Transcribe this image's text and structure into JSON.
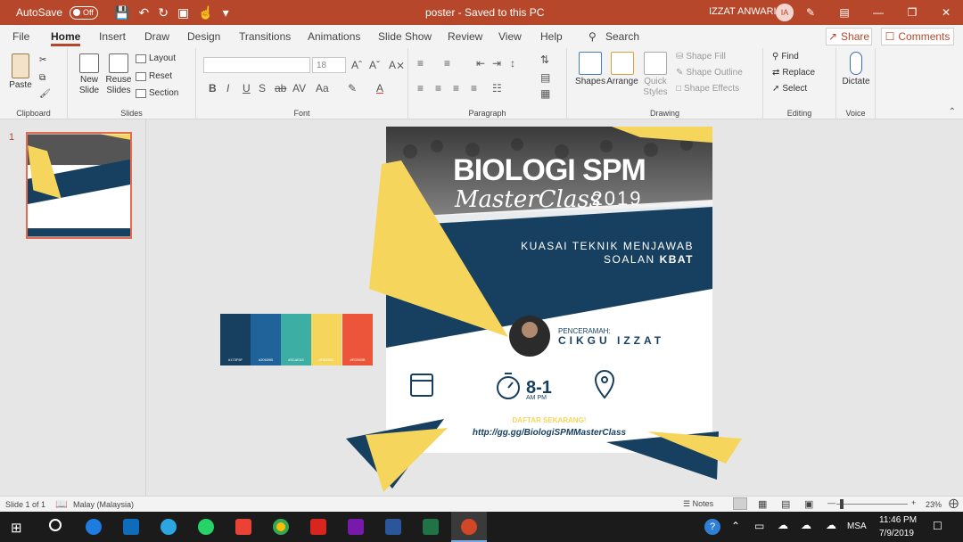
{
  "titlebar": {
    "autosave_label": "AutoSave",
    "autosave_state": "Off",
    "document_title": "poster  -  Saved to this PC",
    "user_name": "IZZAT ANWARI",
    "user_initials": "IA"
  },
  "tabs": [
    "File",
    "Home",
    "Insert",
    "Draw",
    "Design",
    "Transitions",
    "Animations",
    "Slide Show",
    "Review",
    "View",
    "Help"
  ],
  "search_label": "Search",
  "share_label": "Share",
  "comments_label": "Comments",
  "ribbon": {
    "clipboard": {
      "label": "Clipboard",
      "paste": "Paste"
    },
    "slides": {
      "label": "Slides",
      "new_slide": "New Slide",
      "reuse_slides": "Reuse Slides",
      "layout": "Layout",
      "reset": "Reset",
      "section": "Section"
    },
    "font": {
      "label": "Font",
      "font_name": "",
      "font_size": "18"
    },
    "paragraph": {
      "label": "Paragraph"
    },
    "drawing": {
      "label": "Drawing",
      "shapes": "Shapes",
      "arrange": "Arrange",
      "quick_styles": "Quick Styles",
      "shape_fill": "Shape Fill",
      "shape_outline": "Shape Outline",
      "shape_effects": "Shape Effects"
    },
    "editing": {
      "label": "Editing",
      "find": "Find",
      "replace": "Replace",
      "select": "Select"
    },
    "voice": {
      "label": "Voice",
      "dictate": "Dictate"
    }
  },
  "slide_panel": {
    "slide_number": "1"
  },
  "poster": {
    "title_main": "BIOLOGI SPM",
    "title_script": "MasterClass",
    "title_year": "2019",
    "tagline_line1": "KUASAI TEKNIK MENJAWAB",
    "tagline_line2a": "SOALAN ",
    "tagline_line2b": "KBAT",
    "speaker_label": "PENCERAMAH:",
    "speaker_name": "CIKGU IZZAT",
    "time_main": "8-1",
    "time_sub": "AM PM",
    "cta": "DAFTAR SEKARANG!",
    "url": "http://gg.gg/BiologiSPMMasterClass"
  },
  "palette": [
    {
      "hex": "#173F5F",
      "label": "#173F5F"
    },
    {
      "hex": "#20639B",
      "label": "#20639B"
    },
    {
      "hex": "#3CAEA3",
      "label": "#3CAEA3"
    },
    {
      "hex": "#F6D55C",
      "label": "#F6D55C"
    },
    {
      "hex": "#ED553B",
      "label": "#ED553B"
    }
  ],
  "statusbar": {
    "slide_info": "Slide 1 of 1",
    "language": "Malay (Malaysia)",
    "notes": "Notes",
    "zoom": "23%"
  },
  "taskbar": {
    "lang": "MSA",
    "time": "11:46 PM",
    "date": "7/9/2019"
  },
  "colors": {
    "accent": "#B7472A",
    "navy": "#173F5F",
    "yellow": "#F6D55C"
  }
}
